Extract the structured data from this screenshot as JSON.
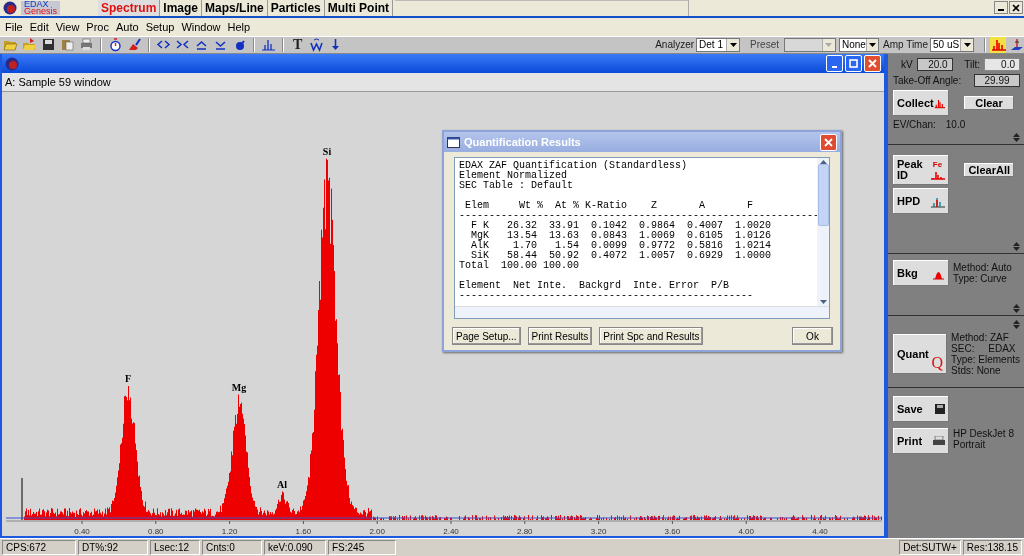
{
  "app": {
    "logo_top": "EDAX",
    "logo_bottom": "Genesis"
  },
  "tabs": [
    {
      "label": "Spectrum",
      "selected": true
    },
    {
      "label": "Image",
      "selected": false
    },
    {
      "label": "Maps/Line",
      "selected": false
    },
    {
      "label": "Particles",
      "selected": false
    },
    {
      "label": "Multi Point",
      "selected": false
    }
  ],
  "menu": [
    "File",
    "Edit",
    "View",
    "Proc",
    "Auto",
    "Setup",
    "Window",
    "Help"
  ],
  "toolbar": {
    "items": [
      {
        "kind": "open"
      },
      {
        "kind": "open-arrow"
      },
      {
        "kind": "save"
      },
      {
        "kind": "clipboard"
      },
      {
        "kind": "print"
      },
      {
        "kind": "separator"
      },
      {
        "kind": "stopwatch"
      },
      {
        "kind": "brush"
      },
      {
        "kind": "separator"
      },
      {
        "kind": "expand"
      },
      {
        "kind": "compress"
      },
      {
        "kind": "up"
      },
      {
        "kind": "down"
      },
      {
        "kind": "blob"
      },
      {
        "kind": "separator"
      },
      {
        "kind": "peaks"
      },
      {
        "kind": "separator"
      },
      {
        "kind": "glyph",
        "text": "T"
      },
      {
        "kind": "w"
      },
      {
        "kind": "arrow-down"
      }
    ],
    "analyzer": {
      "label": "Analyzer",
      "value": "Det 1"
    },
    "preset": {
      "label": "Preset",
      "disabled": true
    },
    "mode": {
      "value": "None"
    },
    "amp_time": {
      "label": "Amp Time",
      "value": "50 uS"
    },
    "view_buttons": [
      {
        "kind": "spectrum",
        "selected": true
      },
      {
        "kind": "stage",
        "selected": false
      }
    ]
  },
  "spectrum_window": {
    "caption": "A: Sample 59 window",
    "peak_labels": [
      "F",
      "Mg",
      "Al",
      "Si"
    ],
    "x_tick_labels": [
      "0.40",
      "0.80",
      "1.20",
      "1.60",
      "2.00",
      "2.40",
      "2.80",
      "3.20",
      "3.60",
      "4.00",
      "4.40"
    ]
  },
  "dialog": {
    "title": "Quantification Results",
    "intro_lines": [
      "EDAX ZAF Quantification (Standardless)",
      "Element Normalized",
      "SEC Table : Default"
    ],
    "table_header": " Elem     Wt %  At % K-Ratio    Z       A       F",
    "table_rule": "------------------------------------------------------------",
    "table_rows": [
      "  F K   26.32  33.91  0.1042  0.9864  0.4007  1.0020",
      "  MgK   13.54  13.63  0.0843  1.0069  0.6105  1.0126",
      "  AlK    1.70   1.54  0.0099  0.9772  0.5816  1.0214",
      "  SiK   58.44  50.92  0.4072  1.0057  0.6929  1.0000",
      "Total  100.00 100.00"
    ],
    "table2_header": "Element  Net Inte.  Backgrd  Inte. Error  P/B",
    "table2_rule": "-------------------------------------------------",
    "buttons": [
      "Page Setup...",
      "Print Results",
      "Print Spc and Results"
    ],
    "ok": "Ok"
  },
  "panel": {
    "sections": [
      {
        "kind": "acquire",
        "kv": {
          "label": "kV",
          "value": "20.0"
        },
        "tilt": {
          "label": "Tilt:",
          "value": "0.0"
        },
        "takeoff": {
          "label": "Take-Off Angle:",
          "value": "29.99"
        },
        "collect": "Collect",
        "clear": "Clear",
        "ev": {
          "label": "EV/Chan:",
          "value": "10.0"
        }
      },
      {
        "kind": "peaks",
        "peak_id": "Peak ID",
        "icon_label": "Fe",
        "clear_all": "ClearAll",
        "hpd": "HPD"
      },
      {
        "kind": "background",
        "button": "Bkg",
        "info": [
          "Method: Auto",
          "Type: Curve"
        ]
      },
      {
        "kind": "quant",
        "button": "Quant",
        "glyph": "Q",
        "info": [
          "Method: ZAF",
          "SEC:     EDAX",
          "Type: Elements",
          "Stds: None"
        ]
      },
      {
        "kind": "output",
        "save": "Save",
        "print": "Print",
        "info": [
          "HP DeskJet 8",
          "Portrait"
        ]
      }
    ]
  },
  "status_bar": {
    "left": [
      "CPS:672",
      "DT%:92",
      "Lsec:12",
      "Cnts:0",
      "keV:0.090",
      "FS:245"
    ],
    "right": [
      "Det:SUTW+",
      "Res:138.15"
    ]
  }
}
